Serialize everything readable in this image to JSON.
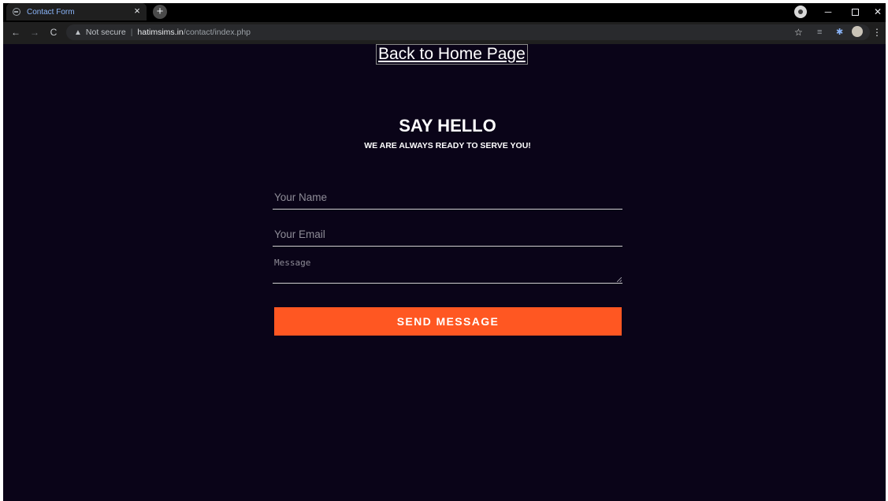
{
  "browser": {
    "tab_title": "Contact Form",
    "tab_close": "×",
    "new_tab": "+",
    "security_label": "Not secure",
    "separator": "|",
    "url_host": "hatimsims.in",
    "url_path": "/contact/index.php",
    "icons": {
      "back": "←",
      "forward": "→",
      "reload": "C",
      "warning": "▲",
      "star": "☆",
      "menu": "⋮",
      "minimize": "─",
      "close": "✕",
      "extension_1": "≡",
      "extension_2": "✱"
    }
  },
  "page": {
    "home_link": "Back to Home Page",
    "heading": "SAY HELLO",
    "subheading": "WE ARE ALWAYS READY TO SERVE YOU!",
    "form": {
      "name_placeholder": "Your Name",
      "email_placeholder": "Your Email",
      "message_placeholder": "Message",
      "submit_label": "SEND MESSAGE"
    }
  },
  "colors": {
    "background": "#0a0418",
    "accent": "#ff5722",
    "text": "#ffffff"
  }
}
